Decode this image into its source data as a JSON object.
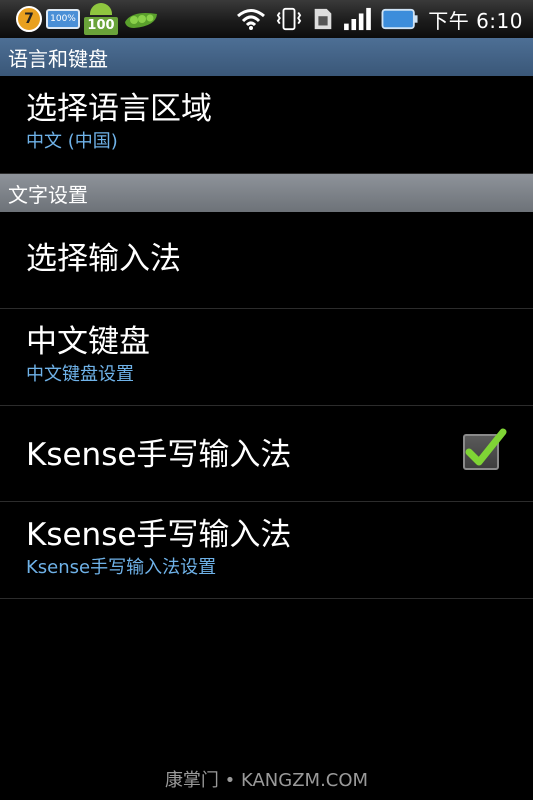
{
  "status_bar": {
    "notification_badge": "7",
    "battery_mini_label": "100%",
    "android_icon_number": "100",
    "time": "下午 6:10",
    "icons": [
      "badge-icon",
      "battery-mini-icon",
      "android-icon",
      "pea-icon",
      "wifi-icon",
      "vibrate-icon",
      "sim-icon",
      "signal-icon",
      "battery-icon"
    ]
  },
  "sections": {
    "language_keyboard": "语言和键盘",
    "text_settings": "文字设置"
  },
  "items": [
    {
      "title": "选择语言区域",
      "subtitle": "中文 (中国)"
    },
    {
      "title": "选择输入法"
    },
    {
      "title": "中文键盘",
      "subtitle": "中文键盘设置"
    },
    {
      "title": "Ksense手写输入法",
      "checked": true
    },
    {
      "title": "Ksense手写输入法",
      "subtitle": "Ksense手写输入法设置"
    }
  ],
  "watermark": "康掌门 • KANGZM.COM",
  "colors": {
    "section_lang": "#3a5778",
    "section_text": "#6d7278",
    "subtitle": "#6fb2e8",
    "check": "#7fd435"
  }
}
